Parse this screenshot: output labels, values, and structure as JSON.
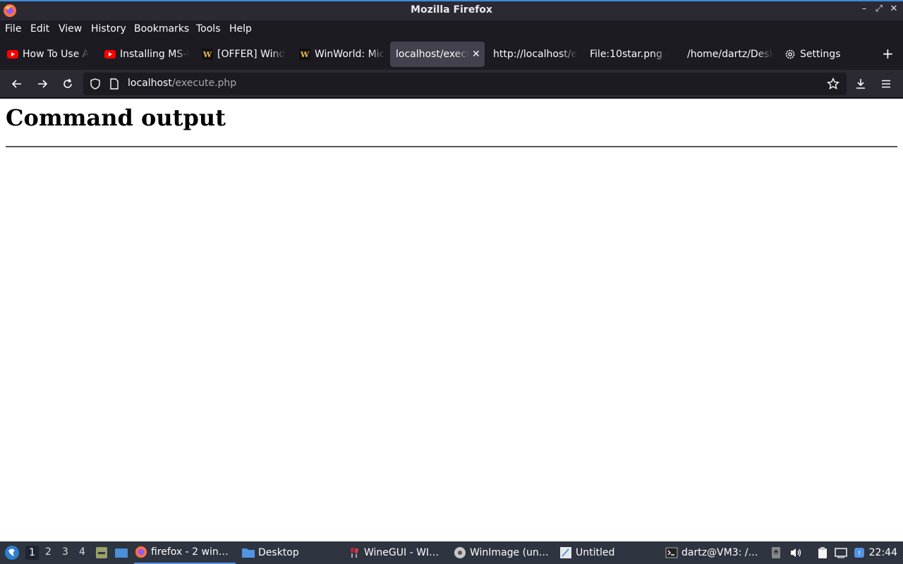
{
  "window": {
    "title": "Mozilla Firefox"
  },
  "menu": {
    "file": "File",
    "edit": "Edit",
    "view": "View",
    "history": "History",
    "bookmarks": "Bookmarks",
    "tools": "Tools",
    "help": "Help"
  },
  "tabs": [
    {
      "label": "How To Use A",
      "icon": "youtube-icon"
    },
    {
      "label": "Installing MS-I",
      "icon": "youtube-icon"
    },
    {
      "label": "[OFFER] Wind",
      "icon": "winworld-icon"
    },
    {
      "label": "WinWorld: Mic",
      "icon": "winworld-icon"
    },
    {
      "label": "localhost/execu",
      "icon": "none",
      "active": true
    },
    {
      "label": "http://localhost/e",
      "icon": "none"
    },
    {
      "label": "File:10star.png -",
      "icon": "none"
    },
    {
      "label": "/home/dartz/Desk",
      "icon": "none"
    },
    {
      "label": "Settings",
      "icon": "gear-icon"
    }
  ],
  "urlbar": {
    "host": "localhost",
    "path": "/execute.php"
  },
  "page": {
    "heading": "Command output"
  },
  "taskbar": {
    "workspaces": [
      "1",
      "2",
      "3",
      "4"
    ],
    "tasks": [
      {
        "label": "firefox - 2 win…",
        "icon": "firefox-icon"
      },
      {
        "label": "Desktop",
        "icon": "folder-icon"
      },
      {
        "label": "WineGUI - WI…",
        "icon": "wine-icon"
      },
      {
        "label": "WinImage (un…",
        "icon": "winimage-icon"
      },
      {
        "label": "Untitled",
        "icon": "editor-icon"
      },
      {
        "label": "dartz@VM3: /…",
        "icon": "terminal-icon"
      }
    ],
    "clock": "22:44"
  },
  "colors": {
    "accent": "#3b8ad8",
    "chrome": "#2b2a33",
    "taskbar": "#2e3440"
  }
}
